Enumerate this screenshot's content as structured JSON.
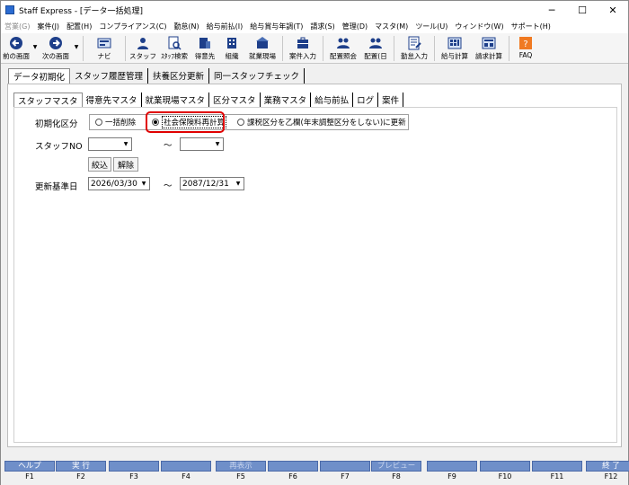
{
  "window": {
    "title": "Staff Express - [データ一括処理]"
  },
  "menu": [
    {
      "label": "営業(G)",
      "disabled": true
    },
    {
      "label": "案件(J)"
    },
    {
      "label": "配置(H)"
    },
    {
      "label": "コンプライアンス(C)"
    },
    {
      "label": "勤怠(N)"
    },
    {
      "label": "給与前払(I)"
    },
    {
      "label": "給与賞与年調(T)"
    },
    {
      "label": "請求(S)"
    },
    {
      "label": "管理(D)"
    },
    {
      "label": "マスタ(M)"
    },
    {
      "label": "ツール(U)"
    },
    {
      "label": "ウィンドウ(W)"
    },
    {
      "label": "サポート(H)"
    }
  ],
  "toolbar": [
    {
      "label": "前の画面",
      "icon": "back-arrow-icon"
    },
    {
      "label": "次の画面",
      "icon": "forward-arrow-icon"
    },
    {
      "label": "ナビ",
      "icon": "navi-icon"
    },
    {
      "label": "スタッフ",
      "icon": "staff-icon"
    },
    {
      "label": "ｽﾀｯﾌ検索",
      "icon": "staff-search-icon"
    },
    {
      "label": "得意先",
      "icon": "client-icon"
    },
    {
      "label": "組織",
      "icon": "organization-icon"
    },
    {
      "label": "就業現場",
      "icon": "worksite-icon"
    },
    {
      "label": "案件入力",
      "icon": "case-entry-icon"
    },
    {
      "label": "配置照会",
      "icon": "placement-inquiry-icon"
    },
    {
      "label": "配置(日",
      "icon": "placement-daily-icon"
    },
    {
      "label": "勤怠入力",
      "icon": "attendance-entry-icon"
    },
    {
      "label": "給与計算",
      "icon": "payroll-icon"
    },
    {
      "label": "請求計算",
      "icon": "billing-icon"
    },
    {
      "label": "FAQ",
      "icon": "faq-icon"
    }
  ],
  "main_tabs": [
    "データ初期化",
    "スタッフ履歴管理",
    "扶養区分更新",
    "同一スタッフチェック"
  ],
  "sub_tabs": [
    "スタッフマスタ",
    "得意先マスタ",
    "就業現場マスタ",
    "区分マスタ",
    "業務マスタ",
    "給与前払",
    "ログ",
    "案件"
  ],
  "form": {
    "init_label": "初期化区分",
    "radio_options": [
      "一括削除",
      "社会保険料再計算",
      "課税区分を乙欄(年末調整区分をしない)に更新"
    ],
    "selected_index": 1,
    "staff_no_label": "スタッフNO",
    "staff_no_from": "",
    "staff_no_to": "",
    "tilde": "～",
    "filter_button": "絞込",
    "clear_button": "解除",
    "date_label": "更新基準日",
    "date_from": "2026/03/30",
    "date_to": "2087/12/31"
  },
  "fkeys": [
    {
      "label": "ヘルプ",
      "key": "F1"
    },
    {
      "label": "実 行",
      "key": "F2"
    },
    {
      "label": "",
      "key": "F3"
    },
    {
      "label": "",
      "key": "F4"
    },
    {
      "label": "再表示",
      "key": "F5",
      "disabled": true
    },
    {
      "label": "",
      "key": "F6"
    },
    {
      "label": "",
      "key": "F7"
    },
    {
      "label": "プレビュー",
      "key": "F8",
      "disabled": true
    },
    {
      "label": "",
      "key": "F9"
    },
    {
      "label": "",
      "key": "F10"
    },
    {
      "label": "",
      "key": "F11"
    },
    {
      "label": "終 了",
      "key": "F12"
    }
  ],
  "colors": {
    "fkey_blue": "#6f8fc9",
    "highlight_red": "#e00000",
    "faq_orange": "#f07a22"
  }
}
